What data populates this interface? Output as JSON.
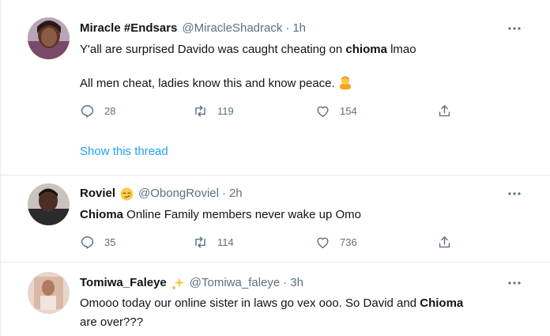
{
  "tweets": [
    {
      "name": "Miracle #Endsars",
      "handle": "@MiracleShadrack",
      "time": "1h",
      "text_1a": "Y'all are surprised  Davido was caught cheating on ",
      "text_1b": "chioma",
      "text_1c": "  lmao",
      "text_2": "All men cheat, ladies know this and know peace.",
      "reply_count": "28",
      "retweet_count": "119",
      "like_count": "154",
      "show_thread": "Show this thread"
    },
    {
      "name": "Roviel",
      "handle": "@ObongRoviel",
      "time": "2h",
      "text_bold": "Chioma",
      "text_rest": " Online Family members never wake up Omo",
      "reply_count": "35",
      "retweet_count": "114",
      "like_count": "736"
    },
    {
      "name": "Tomiwa_Faleye",
      "handle": "@Tomiwa_faleye",
      "time": "3h",
      "text_1a": "Omooo today our online sister in laws go vex ooo. So David and ",
      "text_1b": "Chioma",
      "text_2": "are over???"
    }
  ],
  "colors": {
    "text": "#0f1419",
    "muted": "#5b7083",
    "link": "#1da1f2",
    "border": "#e6ecf0"
  },
  "icons": [
    "more-icon",
    "reply-icon",
    "retweet-icon",
    "like-icon",
    "share-icon",
    "shrug-emoji",
    "smirk-emoji",
    "sparkle-emoji"
  ]
}
